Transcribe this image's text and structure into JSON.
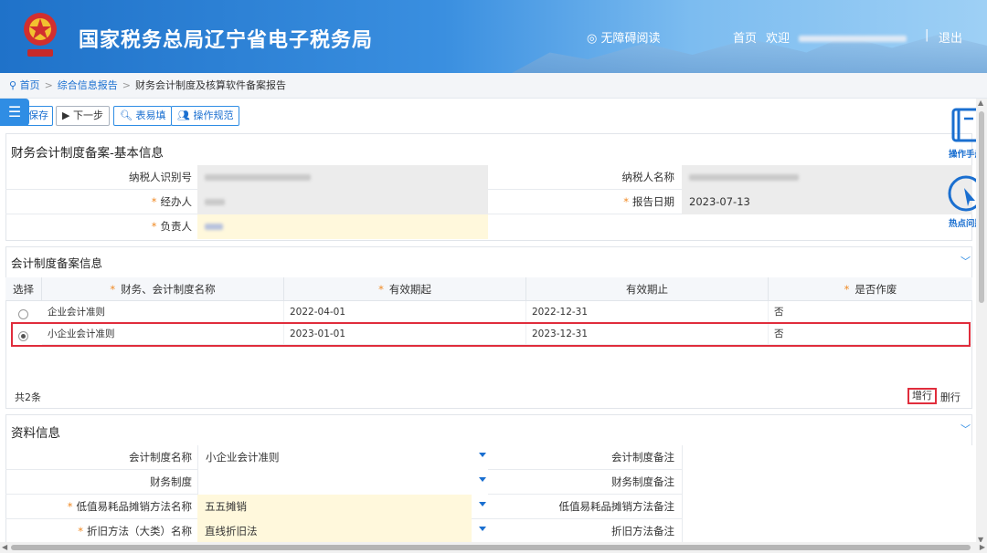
{
  "header": {
    "title": "国家税务总局辽宁省电子税务局",
    "accessibility": "无障碍阅读",
    "home": "首页",
    "welcome": "欢迎",
    "logout": "退出",
    "separator": "|"
  },
  "breadcrumb": {
    "home": "首页",
    "level1": "综合信息报告",
    "current": "财务会计制度及核算软件备案报告",
    "sep": ">"
  },
  "toolbar": {
    "save": "保存",
    "next": "下一步",
    "fill": "表易填",
    "guide": "操作规范"
  },
  "basic": {
    "title": "财务会计制度备案-基本信息",
    "taxpayer_id_label": "纳税人识别号",
    "taxpayer_name_label": "纳税人名称",
    "handler_label": "经办人",
    "report_date_label": "报告日期",
    "report_date": "2023-07-13",
    "responsible_label": "负责人",
    "required_mark": "*"
  },
  "records": {
    "title": "会计制度备案信息",
    "columns": [
      "选择",
      "财务、会计制度名称",
      "有效期起",
      "有效期止",
      "是否作废"
    ],
    "rows": [
      {
        "name": "企业会计准则",
        "start": "2022-04-01",
        "end": "2022-12-31",
        "void": "否",
        "selected": false
      },
      {
        "name": "小企业会计准则",
        "start": "2023-01-01",
        "end": "2023-12-31",
        "void": "否",
        "selected": true
      }
    ],
    "total": "共2条",
    "add_row": "增行",
    "del_row": "删行"
  },
  "material": {
    "title": "资料信息",
    "acct_name_label": "会计制度名称",
    "acct_name": "小企业会计准则",
    "acct_note_label": "会计制度备注",
    "fin_label": "财务制度",
    "fin_note_label": "财务制度备注",
    "lowvalue_label": "低值易耗品摊销方法名称",
    "lowvalue": "五五摊销",
    "lowvalue_note_label": "低值易耗品摊销方法备注",
    "depr_label": "折旧方法（大类）名称",
    "depr": "直线折旧法",
    "depr_note_label": "折旧方法备注"
  },
  "side": {
    "manual": "操作手册",
    "faq": "热点问题"
  },
  "icons": {
    "toggle": "menu-toggle-icon",
    "eye": "eye-icon",
    "location": "location-pin-icon"
  },
  "colors": {
    "accent": "#2f8de4",
    "required": "#f08a24",
    "highlight": "#e02d3c"
  }
}
